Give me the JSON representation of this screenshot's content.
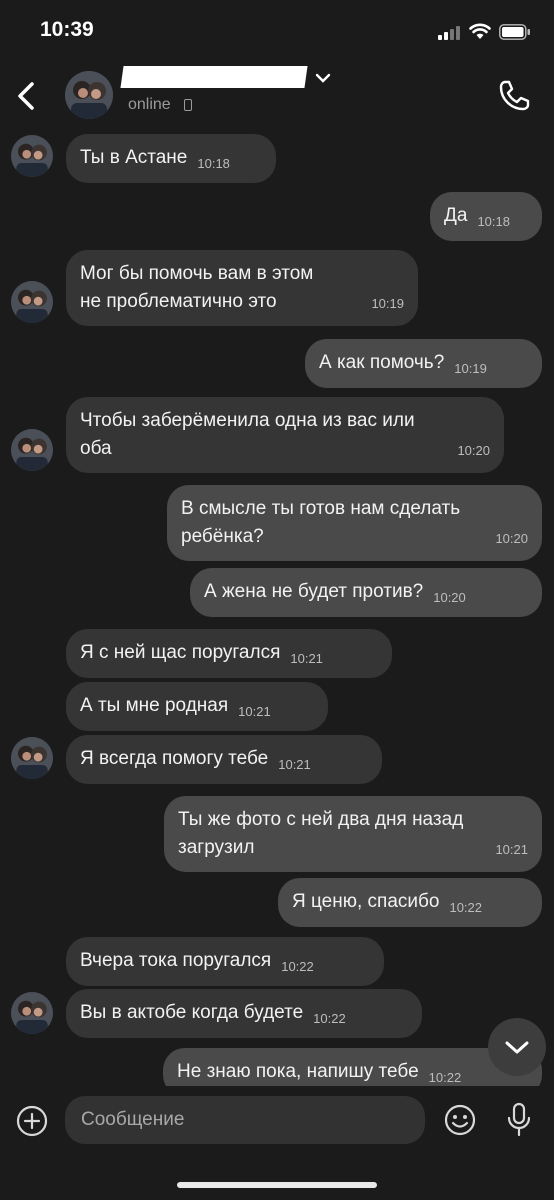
{
  "status_bar": {
    "time": "10:39"
  },
  "header": {
    "status": "online"
  },
  "messages": [
    {
      "dir": "in",
      "text": "Ты в Астане",
      "time": "10:18"
    },
    {
      "dir": "out",
      "text": "Да",
      "time": "10:18"
    },
    {
      "dir": "in",
      "text": "Мог бы помочь вам в этом не проблематично это",
      "time": "10:19"
    },
    {
      "dir": "out",
      "text": "А как помочь?",
      "time": "10:19"
    },
    {
      "dir": "in",
      "text": "Чтобы заберёменила одна из вас или оба",
      "time": "10:20"
    },
    {
      "dir": "out",
      "text": "В смысле ты готов нам сделать ребёнка?",
      "time": "10:20"
    },
    {
      "dir": "out",
      "text": "А жена не будет против?",
      "time": "10:20"
    },
    {
      "dir": "in",
      "text": "Я с ней щас поругался",
      "time": "10:21"
    },
    {
      "dir": "in",
      "text": "А ты мне родная",
      "time": "10:21"
    },
    {
      "dir": "in",
      "text": "Я всегда помогу тебе",
      "time": "10:21"
    },
    {
      "dir": "out",
      "text": "Ты же фото с ней два дня назад загрузил",
      "time": "10:21"
    },
    {
      "dir": "out",
      "text": "Я ценю, спасибо",
      "time": "10:22"
    },
    {
      "dir": "in",
      "text": "Вчера тока поругался",
      "time": "10:22"
    },
    {
      "dir": "in",
      "text": "Вы в актобе когда будете",
      "time": "10:22"
    },
    {
      "dir": "out",
      "text": "Не знаю пока, напишу тебе",
      "time": "10:22"
    }
  ],
  "composer": {
    "placeholder": "Сообщение"
  },
  "icons": {
    "back": "chevron-left-icon",
    "call": "phone-icon",
    "attach": "plus-circle-icon",
    "emoji": "smiley-icon",
    "mic": "microphone-icon",
    "scroll": "chevron-down-icon"
  }
}
